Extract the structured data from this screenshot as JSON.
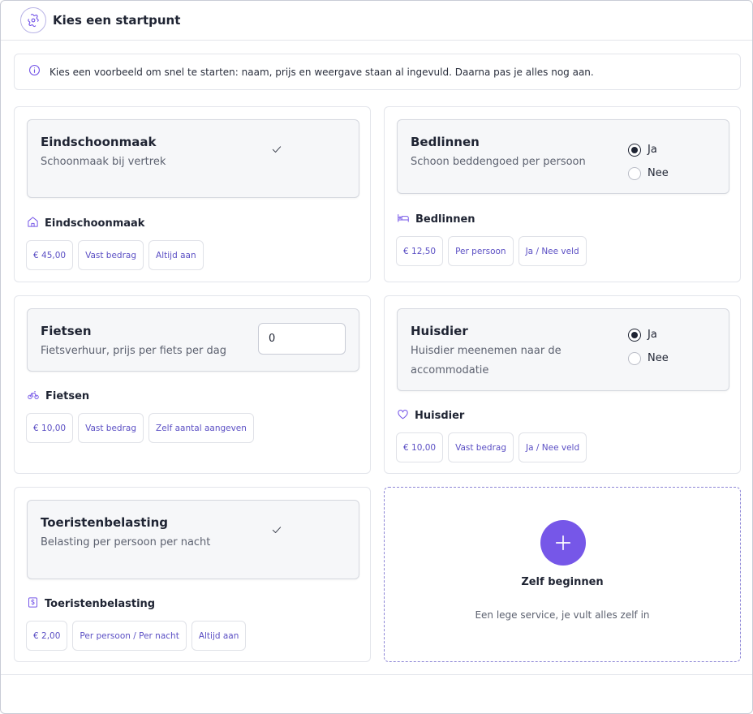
{
  "header": {
    "title": "Kies een startpunt",
    "icon": "puzzle-icon"
  },
  "info": {
    "text": "Kies een voorbeeld om snel te starten: naam, prijs en weergave staan al ingevuld. Daarna pas je alles nog aan.",
    "icon": "info-icon"
  },
  "cards": {
    "eindschoonmaak": {
      "title": "Eindschoonmaak",
      "subtitle": "Schoonmaak bij vertrek",
      "name": "Eindschoonmaak",
      "icon": "home-icon",
      "chips": [
        "€ 45,00",
        "Vast bedrag",
        "Altijd aan"
      ]
    },
    "bedlinnen": {
      "title": "Bedlinnen",
      "subtitle": "Schoon beddengoed per persoon",
      "name": "Bedlinnen",
      "icon": "bed-icon",
      "radio": {
        "yes": "Ja",
        "no": "Nee",
        "selected": "Ja"
      },
      "chips": [
        "€ 12,50",
        "Per persoon",
        "Ja / Nee veld"
      ]
    },
    "fietsen": {
      "title": "Fietsen",
      "subtitle": "Fietsverhuur, prijs per fiets per dag",
      "name": "Fietsen",
      "icon": "bike-icon",
      "input_value": "0",
      "chips": [
        "€ 10,00",
        "Vast bedrag",
        "Zelf aantal aangeven"
      ]
    },
    "huisdier": {
      "title": "Huisdier",
      "subtitle": "Huisdier meenemen naar de accommodatie",
      "name": "Huisdier",
      "icon": "heart-icon",
      "radio": {
        "yes": "Ja",
        "no": "Nee",
        "selected": "Ja"
      },
      "chips": [
        "€ 10,00",
        "Vast bedrag",
        "Ja / Nee veld"
      ]
    },
    "toeristenbelasting": {
      "title": "Toeristenbelasting",
      "subtitle": "Belasting per persoon per nacht",
      "name": "Toeristenbelasting",
      "icon": "receipt-icon",
      "chips": [
        "€ 2,00",
        "Per persoon / Per nacht",
        "Altijd aan"
      ]
    }
  },
  "start": {
    "title": "Zelf beginnen",
    "subtitle": "Een lege service, je vult alles zelf in",
    "icon": "plus-icon"
  },
  "colors": {
    "accent": "#7657e8",
    "chip_text": "#5b4fc4",
    "border": "#e3e5eb"
  }
}
